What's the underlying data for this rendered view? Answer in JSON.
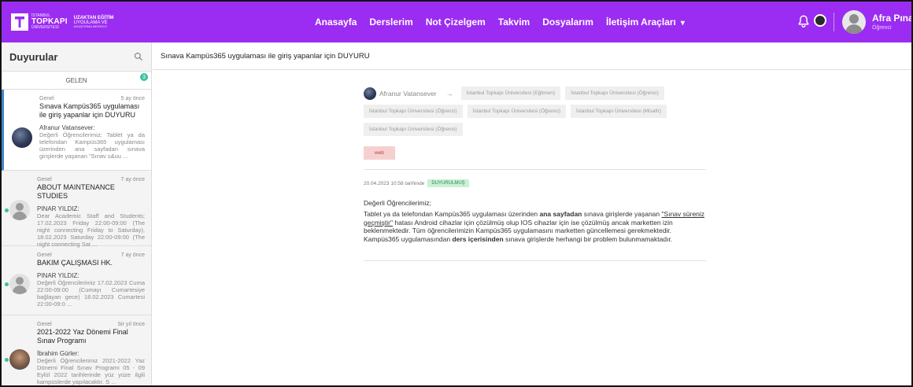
{
  "brand": {
    "line1": "İSTANBUL",
    "name": "TOPKAPI",
    "line3": "ÜNİVERSİTESİ",
    "sub1": "UZAKTAN EĞİTİM",
    "sub2": "UYGULAMA VE",
    "sub3": "ARAŞTIRMA MERKEZİ",
    "color": "#9b2cf1"
  },
  "nav": {
    "items": [
      "Anasayfa",
      "Derslerim",
      "Not Çizelgem",
      "Takvim",
      "Dosyalarım",
      "İletişim Araçları"
    ]
  },
  "user": {
    "name": "Afra Pınar UZEM",
    "role": "Öğrenci"
  },
  "left": {
    "title": "Duyurular",
    "tab": "GELEN",
    "tab_count": "3",
    "messages": [
      {
        "category": "Genel",
        "when": "5 ay önce",
        "subject": "Sınava Kampüs365 uygulaması ile giriş yapanlar için DUYURU",
        "sender": "Afranur Vatansever:",
        "preview": "Değerli Öğrencilerimiz; Tablet ya da telefondan Kampüs365 uygulaması üzerinden ana sayfadan sınava girişlerde yaşanan \"Sınav s&uu ..."
      },
      {
        "category": "Genel",
        "when": "7 ay önce",
        "subject": "ABOUT MAINTENANCE STUDIES",
        "sender": "PINAR YILDIZ:",
        "preview": "Dear Academic Staff and Students; 17.02.2023 Friday 22:00-09:00 (The night connecting Friday to Saturday), 18.02.2023 Saturday 22:00-09:00 (The night connecting Sat ..."
      },
      {
        "category": "Genel",
        "when": "7 ay önce",
        "subject": "BAKIM ÇALIŞMASI HK.",
        "sender": "PINAR YILDIZ:",
        "preview": "Değerli Öğrencilerimiz 17.02.2023 Cuma 22:00-09:00 (Cumayı Cumartesiye bağlayan gece) 18.02.2023 Cumartesi 22:00-09:0 ..."
      },
      {
        "category": "Genel",
        "when": "bir yıl önce",
        "subject": "2021-2022 Yaz Dönemi Final Sınav Programı",
        "sender": "İbrahim Gürler:",
        "preview": "Değerli Öğrencilerimiz 2021-2022 Yaz Dönemi Final Sınav Programı 05 - 09 Eylül 2022 tarihlerinde yüz yüze ilgili kampüslerde yapılacaktır. S ..."
      }
    ]
  },
  "main": {
    "title": "Sınava Kampüs365 uygulaması ile giriş yapanlar için DUYURU",
    "from": "Afranur Vatansever",
    "arrow": "→",
    "recipients": [
      "İstanbul Topkapı Üniversitesi (Eğitmen)",
      "İstanbul Topkapı Üniversitesi (Öğrenci)",
      "İstanbul Topkapı Üniversitesi (Öğrenci)",
      "İstanbul Topkapı Üniversitesi (Öğrenci)",
      "İstanbul Topkapı Üniversitesi (Misafir)",
      "İstanbul Topkapı Üniversitesi (Öğrenci)"
    ],
    "tag": "web",
    "date_text": "20.04.2023 10:58 tarihinde",
    "status": "DUYURULMUŞ",
    "greeting": "Değerli Öğrencilerimiz;",
    "body": {
      "p1": "Tablet ya da telefondan Kampüs365 uygulaması üzerinden ",
      "b1": "ana sayfadan",
      "p2": " sınava girişlerde yaşanan ",
      "u1": "\"Sınav süreniz geçmiştir\"",
      "p3": " hatası Android cihazlar için çözülmüş olup IOS cihazlar için ise çözülmüş ancak marketten izin beklenmektedir. Tüm öğrencilerimizin Kampüs365 uygulamasını marketten güncellemesi gerekmektedir. Kampüs365 uygulamasından ",
      "b2": "ders içerisinden",
      "p4": " sınava girişlerde herhangi bir problem bulunmamaktadır."
    }
  }
}
